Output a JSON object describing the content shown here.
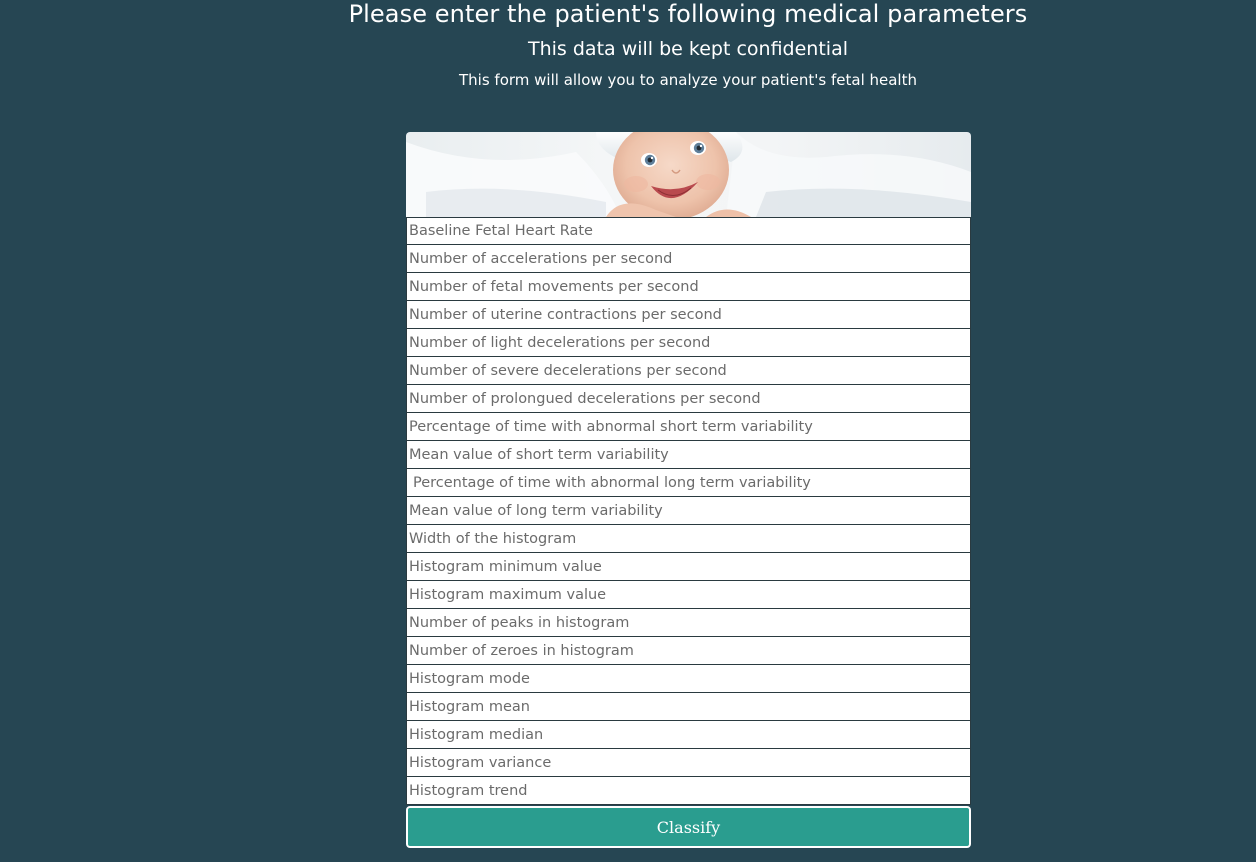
{
  "header": {
    "title": "Please enter the patient's following medical parameters",
    "subtitle": "This data will be kept confidential",
    "tagline": "This form will allow you to analyze your patient's fetal health"
  },
  "banner": {
    "image": "smiling-baby-photo"
  },
  "form": {
    "fields": [
      {
        "placeholder": "Baseline Fetal Heart Rate",
        "value": ""
      },
      {
        "placeholder": "Number of accelerations per second",
        "value": ""
      },
      {
        "placeholder": "Number of fetal movements per second",
        "value": ""
      },
      {
        "placeholder": "Number of uterine contractions per second",
        "value": ""
      },
      {
        "placeholder": "Number of light decelerations per second",
        "value": ""
      },
      {
        "placeholder": "Number of severe decelerations per second",
        "value": ""
      },
      {
        "placeholder": "Number of prolongued decelerations per second",
        "value": ""
      },
      {
        "placeholder": "Percentage of time with abnormal short term variability",
        "value": ""
      },
      {
        "placeholder": "Mean value of short term variability",
        "value": ""
      },
      {
        "placeholder": "Percentage of time with abnormal long term variability",
        "value": ""
      },
      {
        "placeholder": "Mean value of long term variability",
        "value": ""
      },
      {
        "placeholder": "Width of the histogram",
        "value": ""
      },
      {
        "placeholder": "Histogram minimum value",
        "value": ""
      },
      {
        "placeholder": "Histogram maximum value",
        "value": ""
      },
      {
        "placeholder": "Number of peaks in histogram",
        "value": ""
      },
      {
        "placeholder": "Number of zeroes in histogram",
        "value": ""
      },
      {
        "placeholder": "Histogram mode",
        "value": ""
      },
      {
        "placeholder": "Histogram mean",
        "value": ""
      },
      {
        "placeholder": "Histogram median",
        "value": ""
      },
      {
        "placeholder": "Histogram variance",
        "value": ""
      },
      {
        "placeholder": "Histogram trend",
        "value": ""
      }
    ],
    "submit_label": "Classify"
  },
  "colors": {
    "background": "#264653",
    "button": "#2a9d8f",
    "text": "#ffffff"
  }
}
